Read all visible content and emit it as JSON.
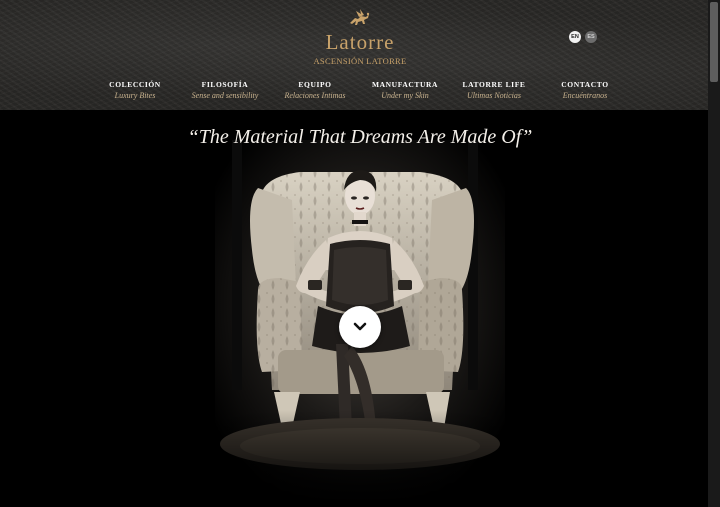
{
  "brand": {
    "name": "Latorre",
    "subtitle": "ASCENSIÓN LATORRE",
    "logo_icon": "winged-horse-icon",
    "accent_color": "#c8a26a"
  },
  "languages": [
    {
      "code": "EN",
      "active": true
    },
    {
      "code": "ES",
      "active": false
    }
  ],
  "nav": [
    {
      "title": "COLECCIÓN",
      "subtitle": "Luxury Bites"
    },
    {
      "title": "FILOSOFÍA",
      "subtitle": "Sense and sensibility"
    },
    {
      "title": "EQUIPO",
      "subtitle": "Relaciones Intimas"
    },
    {
      "title": "MANUFACTURA",
      "subtitle": "Under my Skin"
    },
    {
      "title": "LATORRE LIFE",
      "subtitle": "Ultimas Noticias"
    },
    {
      "title": "CONTACTO",
      "subtitle": "Encuéntranos"
    }
  ],
  "hero": {
    "tagline": "“The Material That Dreams Are Made Of”",
    "scroll_button_icon": "chevron-down-icon"
  }
}
